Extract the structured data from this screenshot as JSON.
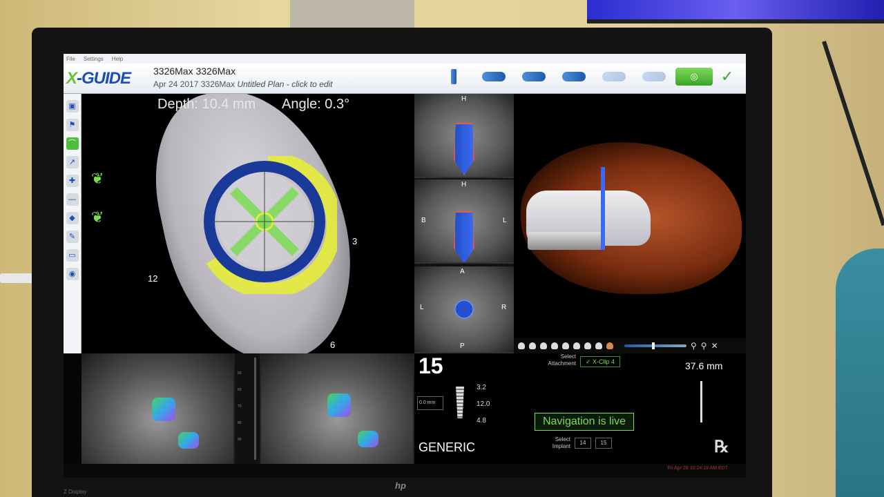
{
  "menu": [
    "File",
    "Settings",
    "Help"
  ],
  "app": {
    "logo": "X-GUIDE",
    "case_title": "3326Max 3326Max",
    "case_date": "Apr 24 2017 3326Max",
    "case_plan": "Untitled Plan - click to edit"
  },
  "workflow": {
    "steps": [
      "implant-step-icon",
      "drill-step-icon",
      "calibrate-step-icon",
      "tracker-step-icon",
      "arch-step-icon",
      "probe-step-icon",
      "navigate-step-icon"
    ],
    "active_step": "navigate-step-icon",
    "done_icon": "✓"
  },
  "nav": {
    "depth": "Depth: 10.4 mm",
    "angle": "Angle: 0.3°",
    "clock_12": "12",
    "clock_3": "3",
    "clock_6": "6"
  },
  "slices": {
    "top": {
      "label_top": "H"
    },
    "mid": {
      "label_top": "H",
      "label_left": "B",
      "label_right": "L"
    },
    "bottom": {
      "label_top": "A",
      "label_left": "L",
      "label_right": "R",
      "label_bottom": "P"
    }
  },
  "info": {
    "tooth_number": "15",
    "library": "GENERIC",
    "spin_value": "0.0 mm",
    "dim_top": "3.2",
    "dim_mid": "12.0",
    "dim_bottom": "4.8",
    "select_attachment_label": "Select Attachment",
    "attachment": "✓ X-Clip 4",
    "navigation_status": "Navigation is live",
    "select_implant_label": "Select Implant",
    "implant_a": "14",
    "implant_b": "15",
    "drill_depth": "37.6 mm",
    "rx": "℞"
  },
  "status": "Fri Apr 28 10:24:18 AM EDT",
  "colors": {
    "accent_green": "#7cdc54",
    "brand_blue": "#1a4fb3",
    "gauge_yellow": "#e6ec3a"
  }
}
